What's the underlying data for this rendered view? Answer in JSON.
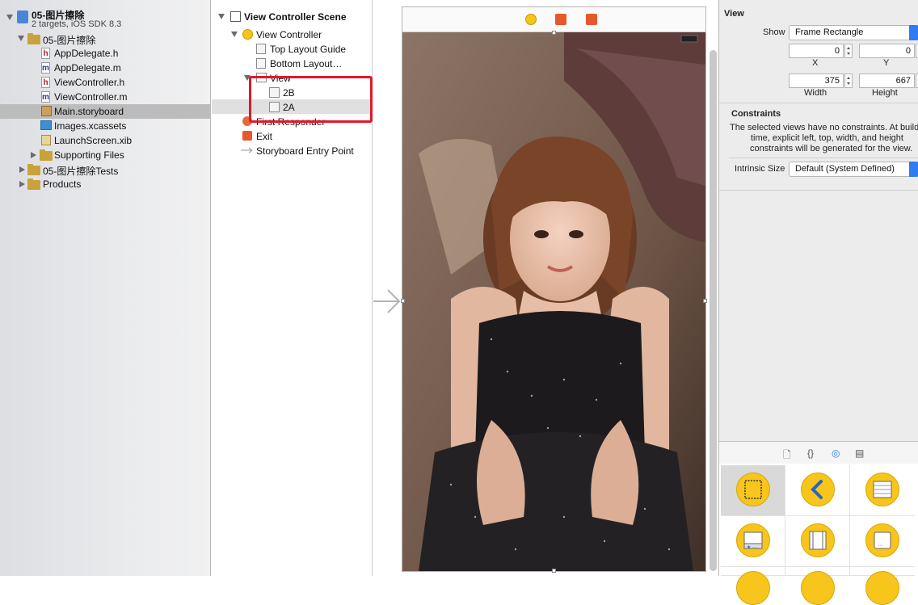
{
  "navigator": {
    "project": {
      "name": "05-图片擦除",
      "subtitle": "2 targets, iOS SDK 8.3"
    },
    "items": [
      {
        "label": "05-图片擦除",
        "kind": "folder"
      },
      {
        "label": "AppDelegate.h",
        "kind": "h"
      },
      {
        "label": "AppDelegate.m",
        "kind": "m"
      },
      {
        "label": "ViewController.h",
        "kind": "h"
      },
      {
        "label": "ViewController.m",
        "kind": "m"
      },
      {
        "label": "Main.storyboard",
        "kind": "storyboard",
        "selected": true
      },
      {
        "label": "Images.xcassets",
        "kind": "xcassets"
      },
      {
        "label": "LaunchScreen.xib",
        "kind": "xib"
      },
      {
        "label": "Supporting Files",
        "kind": "folder"
      },
      {
        "label": "05-图片擦除Tests",
        "kind": "folder"
      },
      {
        "label": "Products",
        "kind": "folder"
      }
    ],
    "icon_glyphs": {
      "h": "h",
      "m": "m"
    }
  },
  "outline": {
    "scene": "View Controller Scene",
    "view_controller": "View Controller",
    "top_layout_guide": "Top Layout Guide",
    "bottom_layout_guide": "Bottom Layout…",
    "view": "View",
    "image_b": "2B",
    "image_a": "2A",
    "first_responder": "First Responder",
    "exit": "Exit",
    "entry_point": "Storyboard Entry Point"
  },
  "inspector": {
    "section": "View",
    "show_label": "Show",
    "show_value": "Frame Rectangle",
    "x_value": "0",
    "y_value": "0",
    "x_label": "X",
    "y_label": "Y",
    "width_value": "375",
    "height_value": "667",
    "width_label": "Width",
    "height_label": "Height",
    "constraints_title": "Constraints",
    "constraints_text_1": "The selected views have no constraints. At build",
    "constraints_text_2": "time, explicit left, top, width, and height",
    "constraints_text_3": "constraints will be generated for the view.",
    "intrinsic_label": "Intrinsic Size",
    "intrinsic_value": "Default (System Defined)",
    "tab_glyphs": {
      "file": "🗋",
      "code": "{}",
      "object": "◎",
      "media": "▤"
    }
  },
  "colors": {
    "accent": "#2f7bf0",
    "highlight_box": "#e0192c",
    "object_yellow": "#f7c51c"
  }
}
